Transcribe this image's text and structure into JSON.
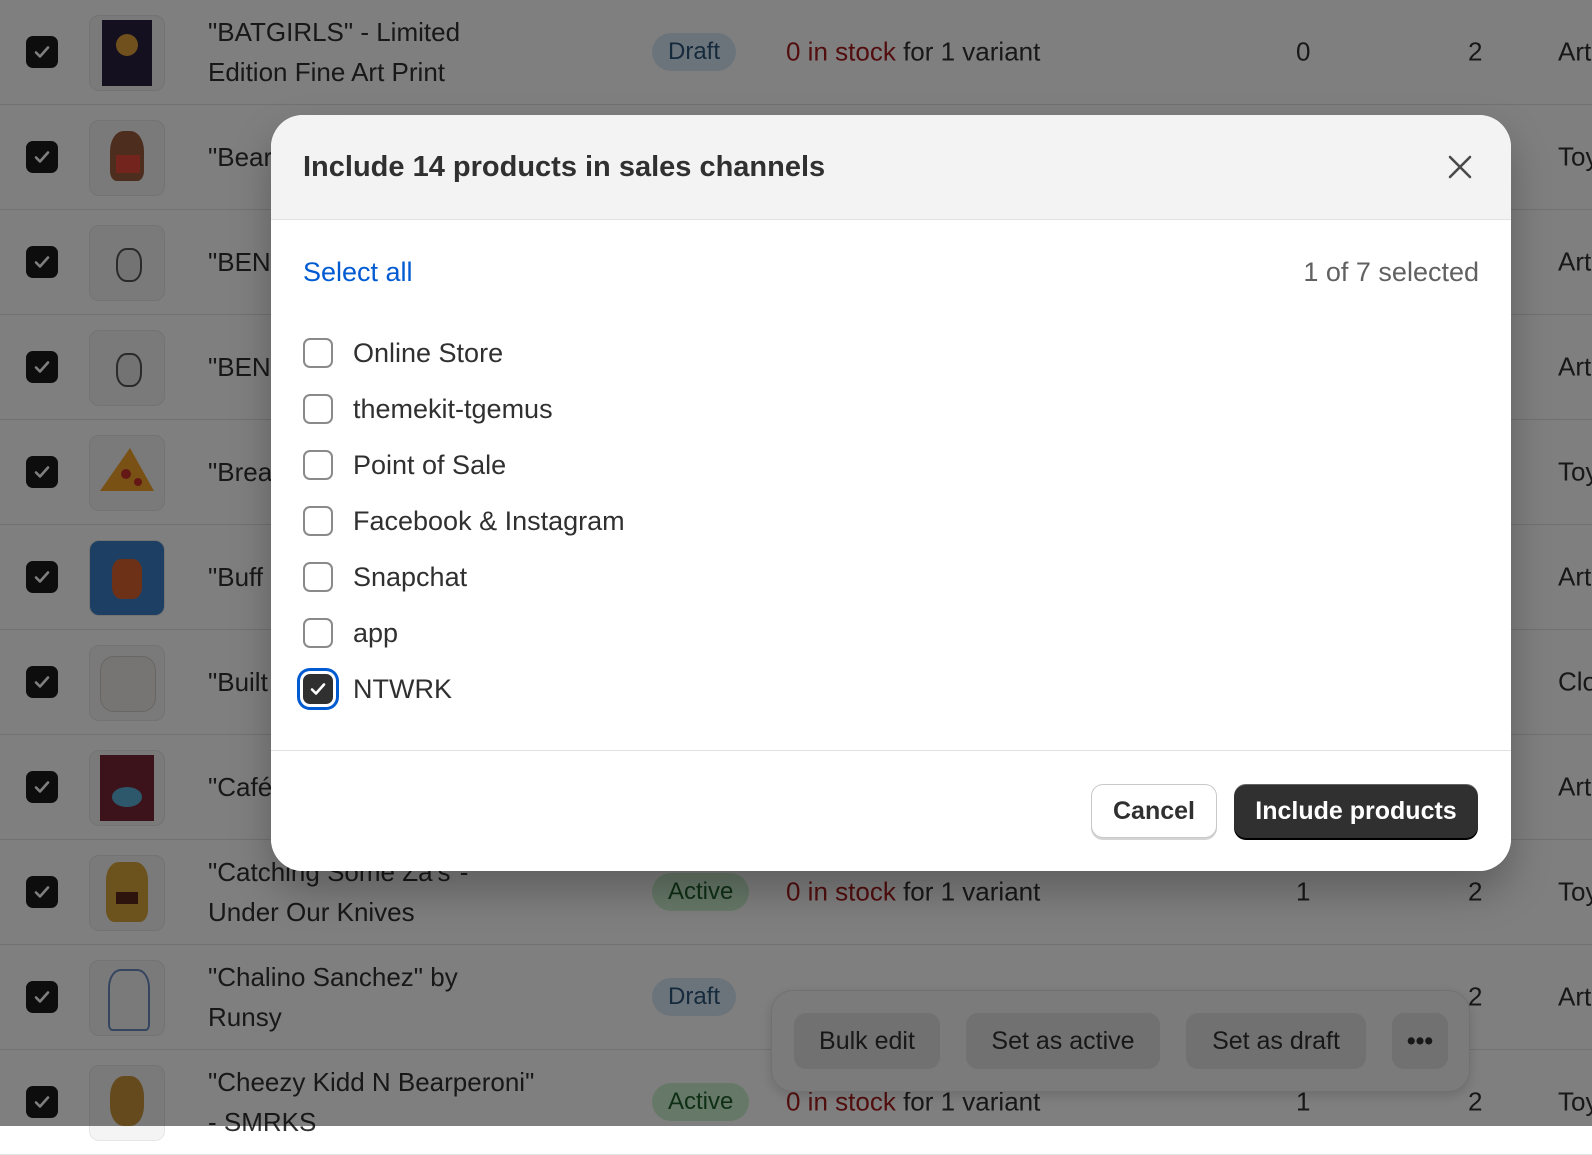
{
  "table": {
    "rows": [
      {
        "name": "\"BATGIRLS\" - Limited Edition Fine Art Print",
        "status": "Draft",
        "stock": "0 in stock",
        "variant": "for 1 variant",
        "c1": "0",
        "c2": "2",
        "type": "Art"
      },
      {
        "name": "\"Bear Break",
        "status": "",
        "stock": "",
        "variant": "",
        "c1": "",
        "c2": "",
        "type": "Toy"
      },
      {
        "name": "\"BEN",
        "status": "",
        "stock": "",
        "variant": "",
        "c1": "",
        "c2": "",
        "type": "Art"
      },
      {
        "name": "\"BEN",
        "status": "",
        "stock": "",
        "variant": "",
        "c1": "",
        "c2": "",
        "type": "Art"
      },
      {
        "name": "\"Brea Goop",
        "status": "",
        "stock": "",
        "variant": "",
        "c1": "",
        "c2": "",
        "type": "Toy"
      },
      {
        "name": "\"Buff Sherb",
        "status": "",
        "stock": "",
        "variant": "",
        "c1": "",
        "c2": "",
        "type": "Art"
      },
      {
        "name": "\"Built Crew",
        "status": "",
        "stock": "",
        "variant": "",
        "c1": "",
        "c2": "",
        "type": "Clo"
      },
      {
        "name": "\"Café",
        "status": "",
        "stock": "",
        "variant": "",
        "c1": "",
        "c2": "",
        "type": "Art"
      },
      {
        "name": "\"Catching Some Za's\"- Under Our Knives",
        "status": "Active",
        "stock": "0 in stock",
        "variant": "for 1 variant",
        "c1": "1",
        "c2": "2",
        "type": "Toy"
      },
      {
        "name": "\"Chalino Sanchez\" by Runsy",
        "status": "Draft",
        "stock": "",
        "variant": "",
        "c1": "",
        "c2": "2",
        "type": "Art"
      },
      {
        "name": "\"Cheezy Kidd N Bearperoni\" - SMRKS",
        "status": "Active",
        "stock": "0 in stock",
        "variant": "for 1 variant",
        "c1": "1",
        "c2": "2",
        "type": "Toy"
      }
    ]
  },
  "bulk_bar": {
    "bulk_edit": "Bulk edit",
    "set_active": "Set as active",
    "set_draft": "Set as draft",
    "more": "•••"
  },
  "modal": {
    "title": "Include 14 products in sales channels",
    "select_all": "Select all",
    "count": "1 of 7 selected",
    "channels": [
      {
        "label": "Online Store",
        "checked": false
      },
      {
        "label": "themekit-tgemus",
        "checked": false
      },
      {
        "label": "Point of Sale",
        "checked": false
      },
      {
        "label": "Facebook & Instagram",
        "checked": false
      },
      {
        "label": "Snapchat",
        "checked": false
      },
      {
        "label": "app",
        "checked": false
      },
      {
        "label": "NTWRK",
        "checked": true
      }
    ],
    "cancel": "Cancel",
    "confirm": "Include products"
  },
  "colors": {
    "accent": "#005bd3",
    "primary_button": "#303030",
    "out_of_stock": "#a51d1d"
  }
}
